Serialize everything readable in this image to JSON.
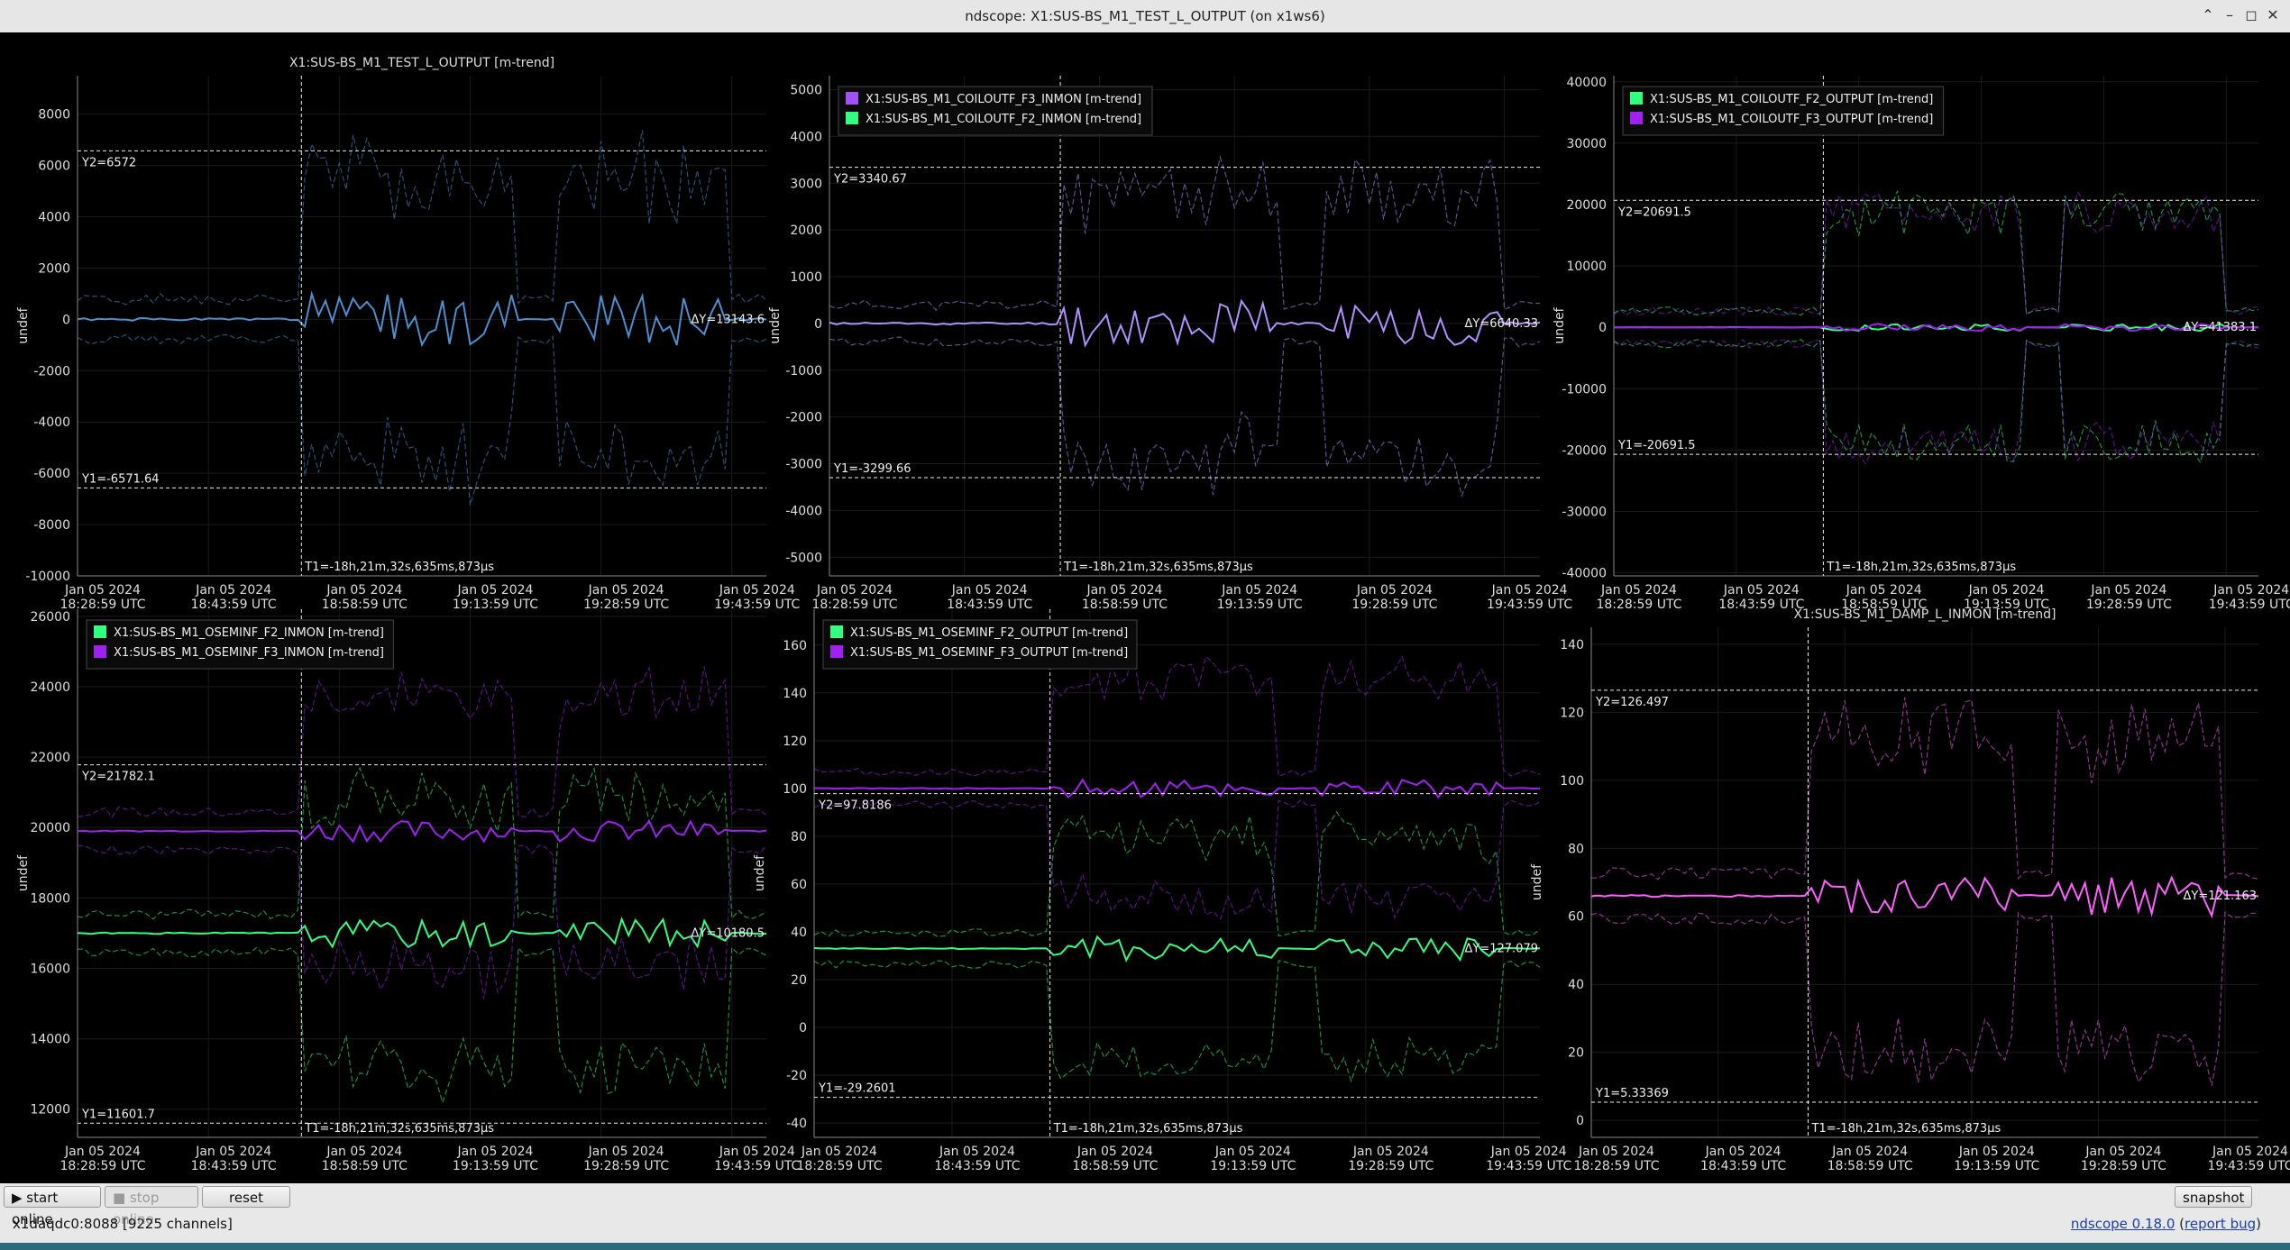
{
  "window": {
    "title": "ndscope: X1:SUS-BS_M1_TEST_L_OUTPUT (on x1ws6)",
    "icons": [
      "restore-icon",
      "minimize-icon",
      "maximize-icon",
      "close-icon"
    ]
  },
  "toolbar": {
    "start_online": "▶ start online",
    "stop_online": "■ stop online",
    "reset": "reset",
    "snapshot": "snapshot"
  },
  "status": {
    "server": "x1daqdc0:8088",
    "channels": "[9225 channels]",
    "version": "ndscope 0.18.0",
    "report_bug": "report bug"
  },
  "colors": {
    "background": "#000000",
    "accent_blue": "#4a8fd0",
    "purple": "#a040ff",
    "green": "#30ff80",
    "magenta": "#ff60ff",
    "lavender": "#b090ff"
  },
  "shared": {
    "ylabel": "undef",
    "t1_label": "T1=-18h,21m,32s,635ms,873µs",
    "x_ticks": [
      [
        "Jan 05 2024",
        "18:28:59 UTC"
      ],
      [
        "Jan 05 2024",
        "18:43:59 UTC"
      ],
      [
        "Jan 05 2024",
        "18:58:59 UTC"
      ],
      [
        "Jan 05 2024",
        "19:13:59 UTC"
      ],
      [
        "Jan 05 2024",
        "19:28:59 UTC"
      ],
      [
        "Jan 05 2024",
        "19:43:59 UTC"
      ]
    ]
  },
  "plots": [
    {
      "title": "X1:SUS-BS_M1_TEST_L_OUTPUT [m-trend]",
      "legend": [],
      "y_ticks": [
        "8000",
        "6000",
        "4000",
        "2000",
        "0",
        "-2000",
        "-4000",
        "-6000",
        "-8000",
        "-10000"
      ],
      "y2_label": "Y2=6572",
      "y1_label": "Y1=-6571.64",
      "dy_label": "ΔY=13143.6",
      "chart_data": {
        "type": "line",
        "ylim": [
          -10000,
          9500
        ],
        "series": [
          {
            "name": "X1:SUS-BS_M1_TEST_L_OUTPUT",
            "color": "#4a8fd0",
            "mean_amplitude": 1000,
            "envelope_amplitude": 6500,
            "mean_level": 0
          }
        ],
        "cursors": {
          "y2": 6572,
          "y1": -6571.64
        }
      }
    },
    {
      "title": "",
      "legend": [
        {
          "name": "X1:SUS-BS_M1_COILOUTF_F3_INMON [m-trend]",
          "color": "#a050ff"
        },
        {
          "name": "X1:SUS-BS_M1_COILOUTF_F2_INMON [m-trend]",
          "color": "#30ff80"
        }
      ],
      "y_ticks": [
        "5000",
        "4000",
        "3000",
        "2000",
        "1000",
        "0",
        "-1000",
        "-2000",
        "-3000",
        "-4000",
        "-5000"
      ],
      "y2_label": "Y2=3340.67",
      "y1_label": "Y1=-3299.66",
      "dy_label": "ΔY=6640.33",
      "chart_data": {
        "type": "line",
        "ylim": [
          -5400,
          5300
        ],
        "series": [
          {
            "name": "X1:SUS-BS_M1_COILOUTF_F3_INMON",
            "color": "#b090ff",
            "mean_amplitude": 500,
            "envelope_amplitude": 3300,
            "mean_level": 0
          }
        ],
        "cursors": {
          "y2": 3340.67,
          "y1": -3299.66
        }
      }
    },
    {
      "title": "",
      "legend": [
        {
          "name": "X1:SUS-BS_M1_COILOUTF_F2_OUTPUT [m-trend]",
          "color": "#30ff80"
        },
        {
          "name": "X1:SUS-BS_M1_COILOUTF_F3_OUTPUT [m-trend]",
          "color": "#a020f0"
        }
      ],
      "y_ticks": [
        "40000",
        "30000",
        "20000",
        "10000",
        "0",
        "-10000",
        "-20000",
        "-30000",
        "-40000"
      ],
      "y2_label": "Y2=20691.5",
      "y1_label": "Y1=-20691.5",
      "dy_label": "ΔY=41383.1",
      "chart_data": {
        "type": "line",
        "ylim": [
          -40500,
          41000
        ],
        "series": [
          {
            "name": "X1:SUS-BS_M1_COILOUTF_F2_OUTPUT",
            "color": "#30ff80",
            "mean_amplitude": 600,
            "envelope_amplitude": 22000,
            "mean_level": 0
          },
          {
            "name": "X1:SUS-BS_M1_COILOUTF_F3_OUTPUT",
            "color": "#a020f0",
            "mean_amplitude": 600,
            "envelope_amplitude": 22000,
            "mean_level": 0
          }
        ],
        "cursors": {
          "y2": 20691.5,
          "y1": -20691.5
        }
      }
    },
    {
      "title": "",
      "legend": [
        {
          "name": "X1:SUS-BS_M1_OSEMINF_F2_INMON [m-trend]",
          "color": "#30ff80"
        },
        {
          "name": "X1:SUS-BS_M1_OSEMINF_F3_INMON [m-trend]",
          "color": "#a020f0"
        }
      ],
      "y_ticks": [
        "26000",
        "24000",
        "22000",
        "20000",
        "18000",
        "16000",
        "14000",
        "12000"
      ],
      "y2_label": "Y2=21782.1",
      "y1_label": "Y1=11601.7",
      "dy_label": "ΔY=10180.5",
      "chart_data": {
        "type": "line",
        "ylim": [
          11200,
          26200
        ],
        "series": [
          {
            "name": "X1:SUS-BS_M1_OSEMINF_F2_INMON",
            "color": "#30ff80",
            "mean_amplitude": 400,
            "envelope_amplitude": 4500,
            "mean_level": 17000
          },
          {
            "name": "X1:SUS-BS_M1_OSEMINF_F3_INMON",
            "color": "#a020f0",
            "mean_amplitude": 300,
            "envelope_amplitude": 4500,
            "mean_level": 19900
          }
        ],
        "cursors": {
          "y2": 21782.1,
          "y1": 11601.7
        }
      }
    },
    {
      "title": "",
      "legend": [
        {
          "name": "X1:SUS-BS_M1_OSEMINF_F2_OUTPUT [m-trend]",
          "color": "#30ff80"
        },
        {
          "name": "X1:SUS-BS_M1_OSEMINF_F3_OUTPUT [m-trend]",
          "color": "#a020f0"
        }
      ],
      "y_ticks": [
        "160",
        "140",
        "120",
        "100",
        "80",
        "60",
        "40",
        "20",
        "0",
        "-20",
        "-40"
      ],
      "y2_label": "Y2=97.8186",
      "y1_label": "Y1=-29.2601",
      "dy_label": "ΔY=127.079",
      "chart_data": {
        "type": "line",
        "ylim": [
          -46,
          175
        ],
        "series": [
          {
            "name": "X1:SUS-BS_M1_OSEMINF_F2_OUTPUT",
            "color": "#30ff80",
            "mean_amplitude": 5,
            "envelope_amplitude": 55,
            "mean_level": 33
          },
          {
            "name": "X1:SUS-BS_M1_OSEMINF_F3_OUTPUT",
            "color": "#a020f0",
            "mean_amplitude": 4,
            "envelope_amplitude": 55,
            "mean_level": 100
          }
        ],
        "cursors": {
          "y2": 97.8186,
          "y1": -29.2601
        }
      }
    },
    {
      "title": "X1:SUS-BS_M1_DAMP_L_INMON [m-trend]",
      "legend": [],
      "y_ticks": [
        "140",
        "120",
        "100",
        "80",
        "60",
        "40",
        "20",
        "0"
      ],
      "y2_label": "Y2=126.497",
      "y1_label": "Y1=5.33369",
      "dy_label": "ΔY=121.163",
      "chart_data": {
        "type": "line",
        "ylim": [
          -5,
          145
        ],
        "series": [
          {
            "name": "X1:SUS-BS_M1_DAMP_L_INMON",
            "color": "#ff60ff",
            "mean_amplitude": 6,
            "envelope_amplitude": 55,
            "mean_level": 66
          }
        ],
        "cursors": {
          "y2": 126.497,
          "y1": 5.33369
        }
      }
    }
  ]
}
